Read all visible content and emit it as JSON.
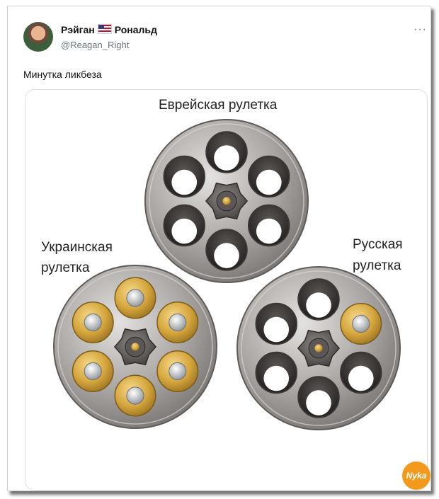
{
  "tweet": {
    "author_name_first": "Рэйган",
    "author_flag_icon": "us-flag-icon",
    "author_name_last": "Рональд",
    "handle": "@Reagan_Right",
    "more_icon": "more-dots-icon",
    "more_glyph": "···",
    "text": "Минутка ликбеза"
  },
  "image": {
    "label_top": "Еврейская рулетка",
    "label_left_line1": "Украинская",
    "label_left_line2": "рулетка",
    "label_right_line1": "Русская",
    "label_right_line2": "рулетка"
  },
  "watermark": {
    "text": "Nyka"
  },
  "colors": {
    "metal": "#a9a6a3",
    "brass": "#d4a53c",
    "text": "#111111",
    "muted": "#6b7680"
  }
}
